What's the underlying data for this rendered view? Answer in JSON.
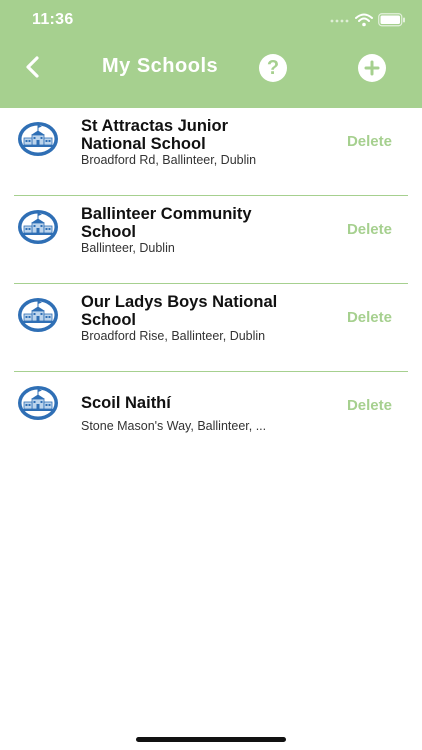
{
  "status_bar": {
    "time": "11:36"
  },
  "nav": {
    "title": "My Schools",
    "help_label": "?"
  },
  "schools": [
    {
      "name": "St Attractas Junior National School",
      "address": "Broadford Rd, Ballinteer, Dublin",
      "action": "Delete"
    },
    {
      "name": "Ballinteer Community School",
      "address": "Ballinteer, Dublin",
      "action": "Delete"
    },
    {
      "name": "Our Ladys Boys National School",
      "address": "Broadford Rise, Ballinteer, Dublin",
      "action": "Delete"
    },
    {
      "name": "Scoil Naithí",
      "address": "Stone Mason's Way, Ballinteer, ...",
      "action": "Delete"
    }
  ],
  "colors": {
    "accent": "#a6d08f",
    "icon_blue": "#2f6fb5"
  }
}
